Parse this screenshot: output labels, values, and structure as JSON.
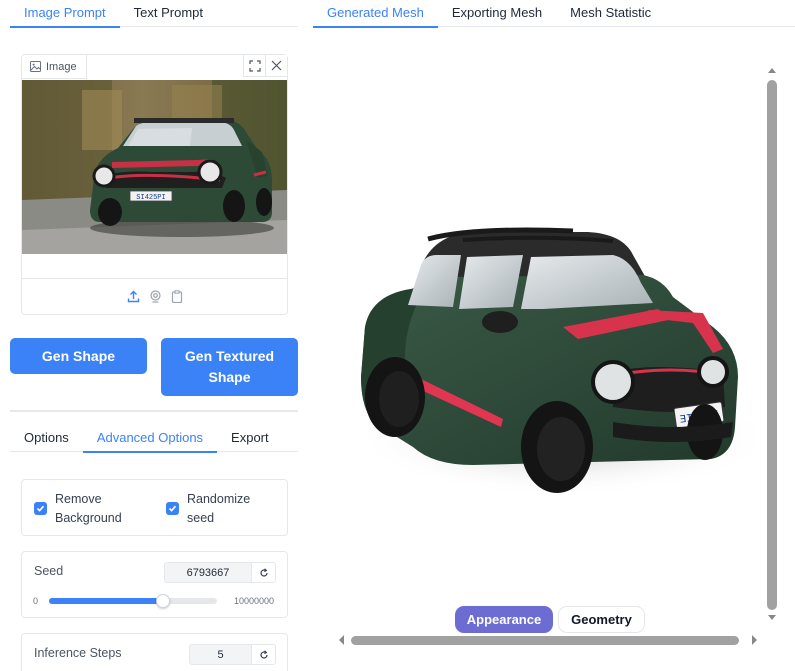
{
  "prompt_tabs": [
    {
      "label": "Image Prompt",
      "active": true
    },
    {
      "label": "Text Prompt",
      "active": false
    }
  ],
  "viewer_tabs": [
    {
      "label": "Generated Mesh",
      "active": true
    },
    {
      "label": "Exporting Mesh",
      "active": false
    },
    {
      "label": "Mesh Statistic",
      "active": false
    }
  ],
  "image_input": {
    "label": "Image",
    "plate_text": "SI425PI"
  },
  "buttons": {
    "gen_shape": "Gen Shape",
    "gen_textured": "Gen Textured Shape"
  },
  "option_tabs": [
    {
      "label": "Options",
      "active": false
    },
    {
      "label": "Advanced Options",
      "active": true
    },
    {
      "label": "Export",
      "active": false
    }
  ],
  "checkboxes": {
    "remove_background": {
      "label": "Remove Background",
      "checked": true
    },
    "randomize_seed": {
      "label": "Randomize seed",
      "checked": true
    }
  },
  "seed": {
    "label": "Seed",
    "value": "6793667",
    "min": "0",
    "max": "10000000",
    "fraction": 0.6793667
  },
  "inference_steps": {
    "label": "Inference Steps",
    "value": "5"
  },
  "mesh_plate_text": "ƎINHPI",
  "view_toggles": {
    "appearance": "Appearance",
    "geometry": "Geometry",
    "active": "appearance"
  },
  "colors": {
    "accent": "#3b82f6",
    "toggle_active": "#6d6cd3",
    "car_body": "#2f4a39",
    "car_stripe": "#d8334c"
  }
}
